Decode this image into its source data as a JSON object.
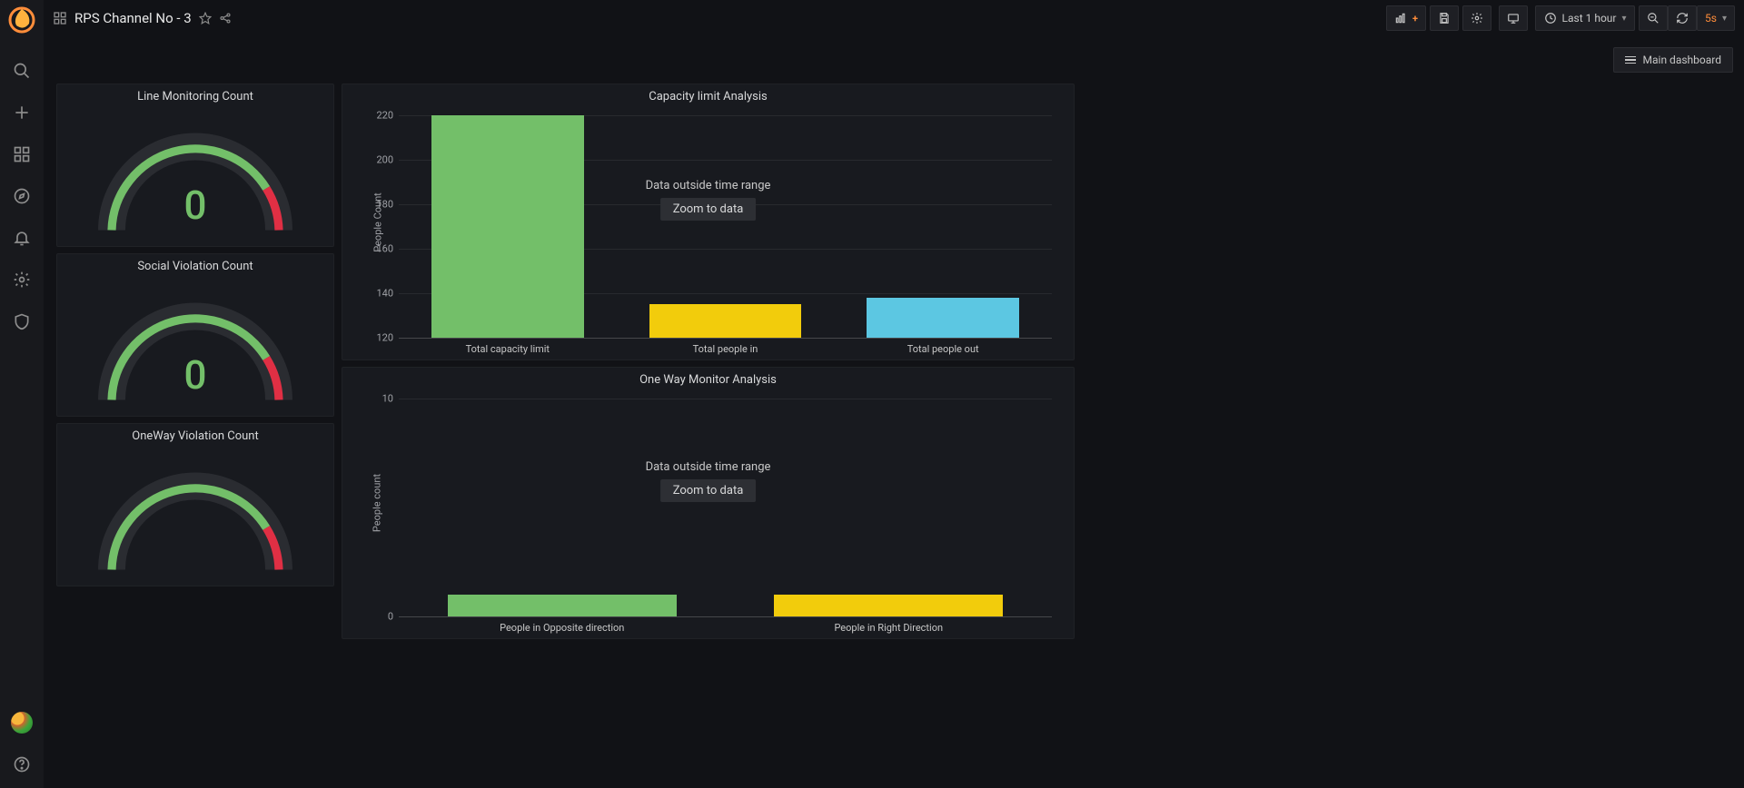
{
  "header": {
    "title": "RPS Channel No - 3",
    "time_range_label": "Last 1 hour",
    "refresh_interval": "5s",
    "main_dashboard_label": "Main dashboard"
  },
  "sidebar": {
    "icons": [
      "search",
      "plus",
      "apps",
      "compass",
      "bell",
      "gear",
      "shield"
    ]
  },
  "gauges": [
    {
      "title": "Line Monitoring Count",
      "value": "0"
    },
    {
      "title": "Social Violation Count",
      "value": "0"
    },
    {
      "title": "OneWay Violation Count",
      "value": ""
    }
  ],
  "overlay": {
    "data_outside": "Data outside time range",
    "zoom_label": "Zoom to data"
  },
  "chart_data": [
    {
      "type": "bar",
      "title": "Capacity limit Analysis",
      "ylabel": "People Count",
      "ylim": [
        120,
        220
      ],
      "ticks": [
        120,
        140,
        160,
        180,
        200,
        220
      ],
      "categories": [
        "Total capacity limit",
        "Total people in",
        "Total people out"
      ],
      "series": [
        {
          "name": "Total capacity limit",
          "value": 220,
          "color": "#73bf69"
        },
        {
          "name": "Total people in",
          "value": 135,
          "color": "#f2cc0c"
        },
        {
          "name": "Total people out",
          "value": 138,
          "color": "#5cc7e2"
        }
      ]
    },
    {
      "type": "bar",
      "title": "One Way Monitor Analysis",
      "ylabel": "People count",
      "ylim": [
        0,
        10
      ],
      "ticks": [
        0,
        10
      ],
      "categories": [
        "People in Opposite direction",
        "People in Right Direction"
      ],
      "series": [
        {
          "name": "People in Opposite direction",
          "value": 1,
          "color": "#73bf69"
        },
        {
          "name": "People in Right Direction",
          "value": 1,
          "color": "#f2cc0c"
        }
      ]
    }
  ]
}
